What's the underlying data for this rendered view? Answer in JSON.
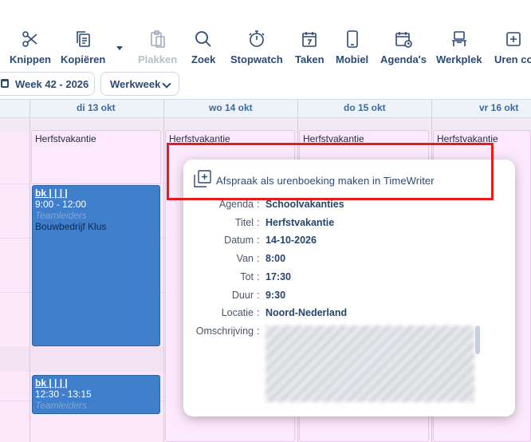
{
  "toolbar": {
    "items": [
      {
        "label": "Knippen",
        "icon": "scissors-icon",
        "enabled": true
      },
      {
        "label": "Kopiëren",
        "icon": "copy-icon",
        "enabled": true
      },
      {
        "label": "Plakken",
        "icon": "paste-icon",
        "enabled": false
      },
      {
        "label": "Zoek",
        "icon": "search-icon",
        "enabled": true
      },
      {
        "label": "Stopwatch",
        "icon": "stopwatch-icon",
        "enabled": true
      },
      {
        "label": "Taken",
        "icon": "tasks-calendar-icon",
        "enabled": true
      },
      {
        "label": "Mobiel",
        "icon": "mobile-icon",
        "enabled": true
      },
      {
        "label": "Agenda's",
        "icon": "agendas-icon",
        "enabled": true
      },
      {
        "label": "Werkplek",
        "icon": "workplace-icon",
        "enabled": true
      },
      {
        "label": "Uren co",
        "icon": "hours-icon",
        "enabled": true
      }
    ]
  },
  "nav": {
    "week_label": "Week 42 - 2026",
    "view_label": "Werkweek"
  },
  "days": [
    "di 13 okt",
    "wo 14 okt",
    "do 15 okt",
    "vr 16 okt"
  ],
  "events": {
    "holiday_title": "Herfstvakantie",
    "e1": {
      "title": "bk | | | |",
      "time": "9:00 - 12:00",
      "group": "Teamleiders",
      "desc": "Bouwbedrijf Klus"
    },
    "e2": {
      "title": "bk | | | |",
      "time": "12:30 - 13:15",
      "group": "Teamleiders"
    }
  },
  "popup": {
    "action_label": "Afspraak als urenboeking maken in TimeWriter",
    "fields": [
      {
        "label": "Agenda",
        "value": "Schoolvakanties"
      },
      {
        "label": "Titel",
        "value": "Herfstvakantie"
      },
      {
        "label": "Datum",
        "value": "14-10-2026"
      },
      {
        "label": "Van",
        "value": "8:00"
      },
      {
        "label": "Tot",
        "value": "17:30"
      },
      {
        "label": "Duur",
        "value": "9:30"
      },
      {
        "label": "Locatie",
        "value": "Noord-Nederland"
      },
      {
        "label": "Omschrijving",
        "value": ""
      }
    ]
  },
  "colors": {
    "highlight": "#e11d1d",
    "event_blue": "#3f7ecb",
    "holiday_pink": "#fde9fd"
  }
}
